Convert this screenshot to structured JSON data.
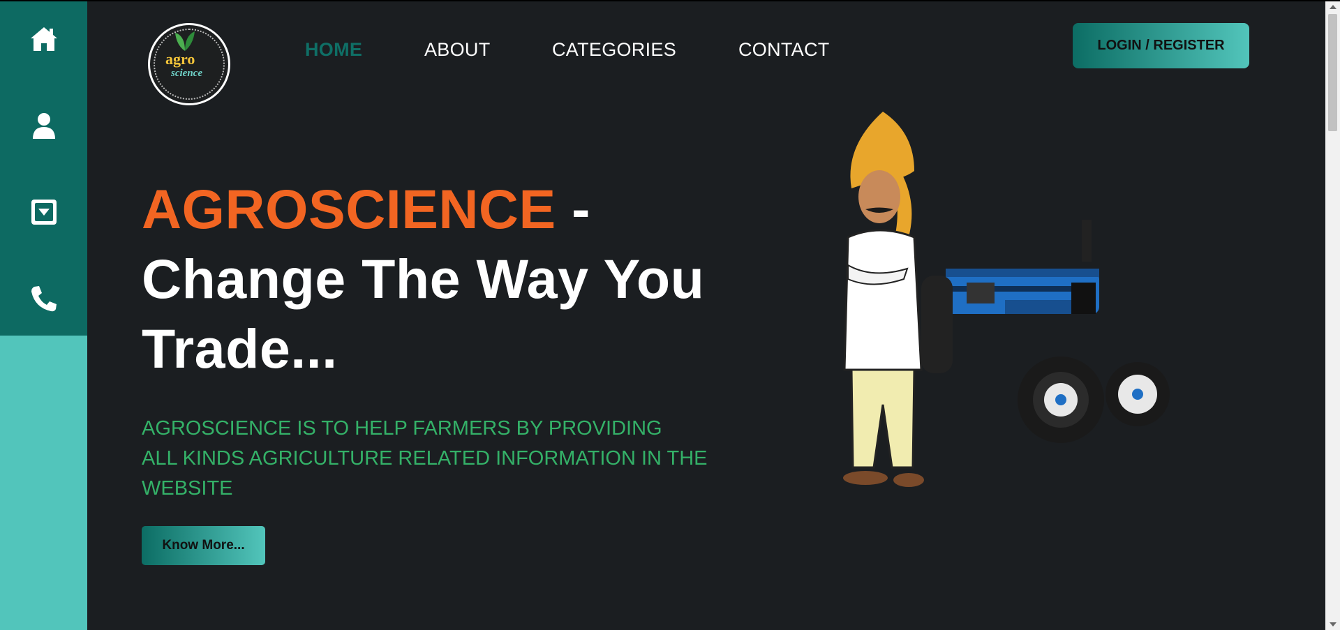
{
  "sidebar": {
    "items": [
      {
        "icon": "home-icon",
        "label": "Home"
      },
      {
        "icon": "user-icon",
        "label": "Profile"
      },
      {
        "icon": "dropdown-box-icon",
        "label": "Categories"
      },
      {
        "icon": "phone-icon",
        "label": "Contact"
      }
    ]
  },
  "logo": {
    "line1": "agro",
    "line2": "science"
  },
  "nav": {
    "home": "HOME",
    "about": "ABOUT",
    "categories": "CATEGORIES",
    "contact": "CONTACT"
  },
  "header": {
    "login_label": "LOGIN / REGISTER"
  },
  "hero": {
    "brand": "AGROSCIENCE",
    "dash": " -",
    "tagline": "Change The Way You Trade...",
    "description_line1": "AGROSCIENCE IS TO HELP FARMERS BY PROVIDING",
    "description_line2": "ALL KINDS AGRICULTURE RELATED INFORMATION IN THE",
    "description_line3": "WEBSITE",
    "button_label": "Know More..."
  },
  "colors": {
    "sidebar_dark": "#0d6a62",
    "sidebar_light": "#52c5bb",
    "background": "#1b1e21",
    "brand_orange": "#f26522",
    "description_green": "#34b168",
    "nav_active": "#0f6f66"
  }
}
